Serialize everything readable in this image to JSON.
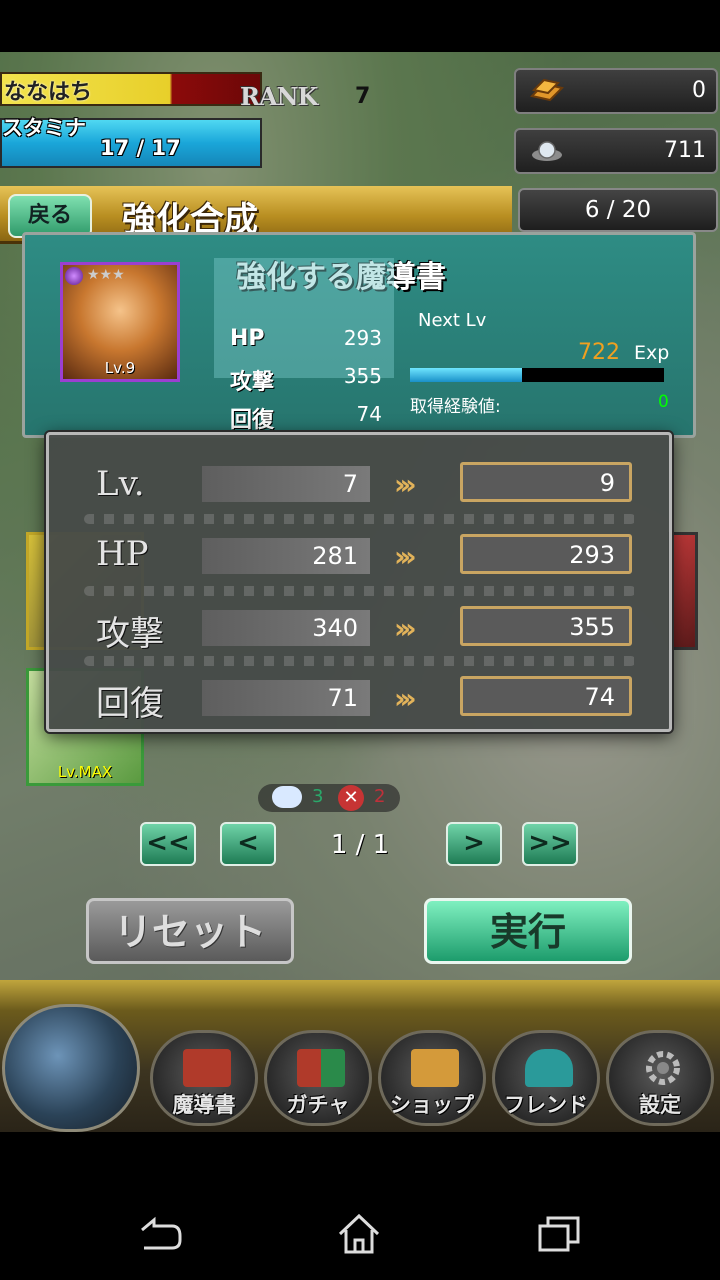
{
  "header": {
    "player_name": "ななはち",
    "rank_label": "RANK",
    "rank_value": "7",
    "stamina_label": "スタミナ",
    "stamina_value": "17 / 17",
    "gold_value": "0",
    "crystal_value": "711"
  },
  "title_bar": {
    "back_label": "戻る",
    "title": "強化合成",
    "count": "6 / 20"
  },
  "grimoire": {
    "panel_title": "強化する魔導書",
    "stars": "★★★",
    "level": "Lv.9",
    "stats": [
      {
        "label": "HP",
        "value": "293"
      },
      {
        "label": "攻撃",
        "value": "355"
      },
      {
        "label": "回復",
        "value": "74"
      }
    ],
    "next_lv_label": "Next Lv",
    "exp_value": "722",
    "exp_unit": "Exp",
    "exp_progress": 0.44,
    "gain_label": "取得経験値:",
    "gain_value": "0"
  },
  "list": {
    "card2_level": "Lv.MAX"
  },
  "counters": {
    "ok": "3",
    "ng": "2",
    "ng_icon": "✕"
  },
  "pager": {
    "first": "<<",
    "prev": "<",
    "text": "1 / 1",
    "next": ">",
    "last": ">>"
  },
  "actions": {
    "reset": "リセット",
    "execute": "実行"
  },
  "nav": {
    "grimoire": "魔導書",
    "gacha": "ガチャ",
    "shop": "ショップ",
    "friend": "フレンド",
    "settings": "設定"
  },
  "modal": {
    "rows": [
      {
        "label": "Lv.",
        "old": "7",
        "arrow": "›››",
        "new": "9"
      },
      {
        "label": "HP",
        "old": "281",
        "arrow": "›››",
        "new": "293"
      },
      {
        "label": "攻撃",
        "old": "340",
        "arrow": "›››",
        "new": "355"
      },
      {
        "label": "回復",
        "old": "71",
        "arrow": "›››",
        "new": "74"
      }
    ]
  },
  "colors": {
    "accent_green": "#2f9a6a",
    "gold": "#b88e21",
    "exp_orange": "#f0a020"
  }
}
